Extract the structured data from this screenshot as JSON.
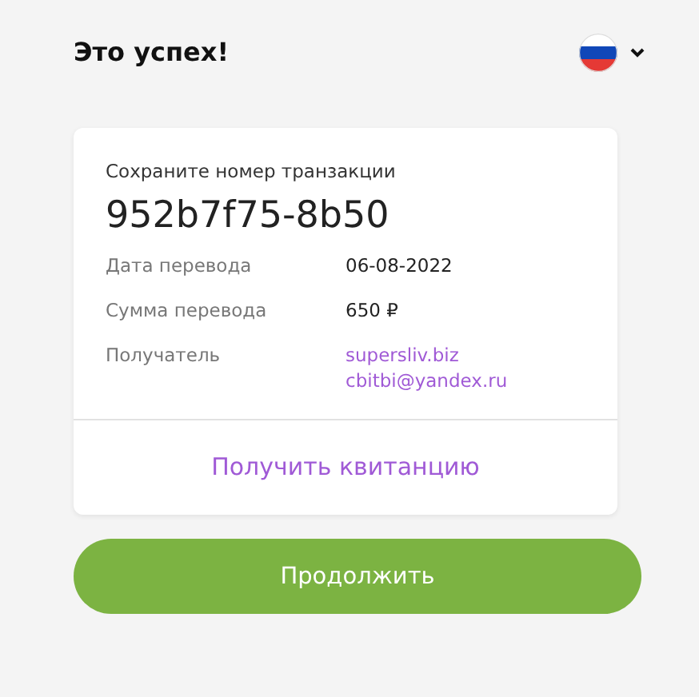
{
  "header": {
    "title": "Это успех!"
  },
  "card": {
    "caption": "Сохраните номер транзакции",
    "transaction_id": "952b7f75-8b50",
    "rows": [
      {
        "label": "Дата перевода",
        "kind": "text",
        "values": [
          "06-08-2022"
        ]
      },
      {
        "label": "Сумма перевода",
        "kind": "text",
        "values": [
          "650 ₽"
        ]
      },
      {
        "label": "Получатель",
        "kind": "link",
        "values": [
          "supersliv.biz",
          "cbitbi@yandex.ru"
        ]
      }
    ],
    "receipt_link": "Получить квитанцию"
  },
  "buttons": [
    "Продолжить"
  ]
}
